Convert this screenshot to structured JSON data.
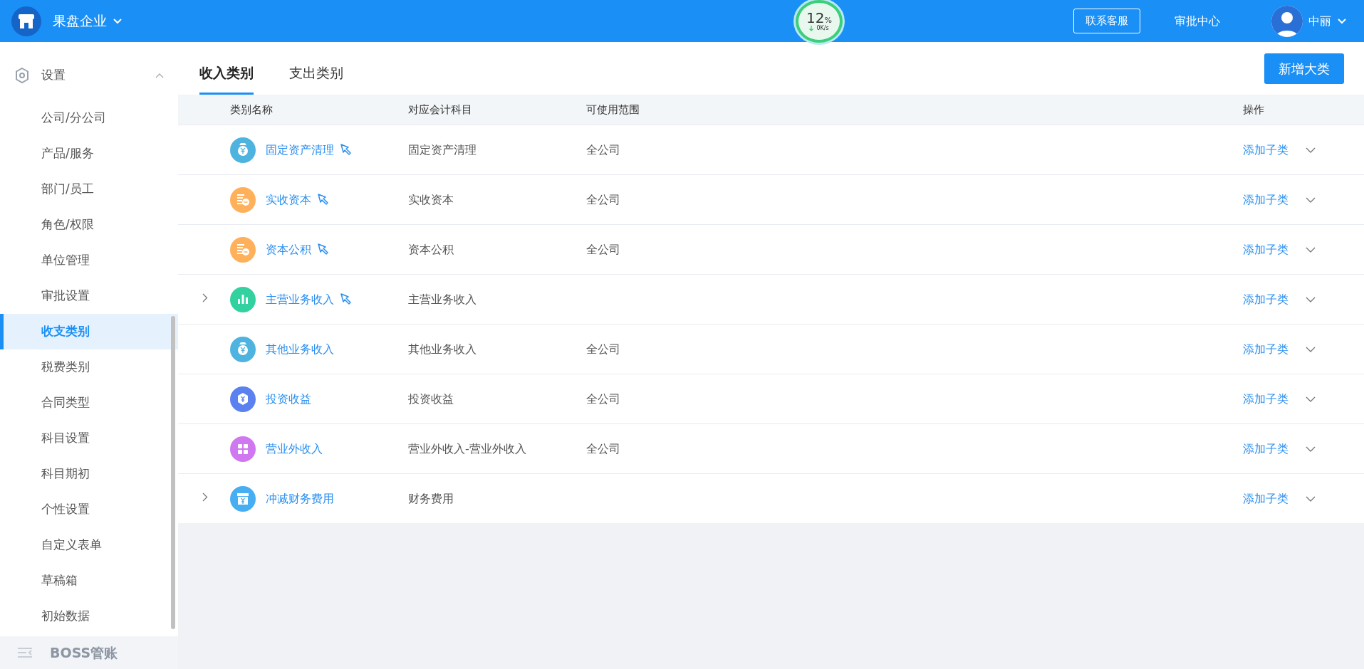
{
  "header": {
    "company": "果盘企业",
    "monitor": {
      "value": "12",
      "unit": "%",
      "speed": "0K/s"
    },
    "support_button": "联系客服",
    "approval_link": "审批中心",
    "user": "中丽"
  },
  "sidebar": {
    "group": {
      "label": "设置",
      "expanded": true
    },
    "items": [
      {
        "label": "公司/分公司",
        "selected": false
      },
      {
        "label": "产品/服务",
        "selected": false
      },
      {
        "label": "部门/员工",
        "selected": false
      },
      {
        "label": "角色/权限",
        "selected": false
      },
      {
        "label": "单位管理",
        "selected": false
      },
      {
        "label": "审批设置",
        "selected": false
      },
      {
        "label": "收支类别",
        "selected": true
      },
      {
        "label": "税费类别",
        "selected": false
      },
      {
        "label": "合同类型",
        "selected": false
      },
      {
        "label": "科目设置",
        "selected": false
      },
      {
        "label": "科目期初",
        "selected": false
      },
      {
        "label": "个性设置",
        "selected": false
      },
      {
        "label": "自定义表单",
        "selected": false
      },
      {
        "label": "草稿箱",
        "selected": false
      },
      {
        "label": "初始数据",
        "selected": false
      }
    ],
    "footer": "BOSS管账"
  },
  "tabs": [
    {
      "label": "收入类别",
      "selected": true
    },
    {
      "label": "支出类别",
      "selected": false
    }
  ],
  "add_button": "新增大类",
  "table": {
    "columns": [
      "类别名称",
      "对应会计科目",
      "可使用范围",
      "操作"
    ],
    "rows": [
      {
        "name": "固定资产清理",
        "kind": "bag",
        "color": "#4fb3e0",
        "pinned": true,
        "expandable": false,
        "account": "固定资产清理",
        "scope": "全公司",
        "action": "添加子类"
      },
      {
        "name": "实收资本",
        "kind": "coins",
        "color": "#ffb05a",
        "pinned": true,
        "expandable": false,
        "account": "实收资本",
        "scope": "全公司",
        "action": "添加子类"
      },
      {
        "name": "资本公积",
        "kind": "coins",
        "color": "#ffb05a",
        "pinned": true,
        "expandable": false,
        "account": "资本公积",
        "scope": "全公司",
        "action": "添加子类"
      },
      {
        "name": "主营业务收入",
        "kind": "chart",
        "color": "#33d19f",
        "pinned": true,
        "expandable": true,
        "account": "主营业务收入",
        "action": "添加子类"
      },
      {
        "name": "其他业务收入",
        "kind": "bag",
        "color": "#4fb3e0",
        "pinned": false,
        "expandable": false,
        "account": "其他业务收入",
        "scope": "全公司",
        "action": "添加子类"
      },
      {
        "name": "投资收益",
        "kind": "hexagon",
        "color": "#5b80f0",
        "pinned": false,
        "expandable": false,
        "account": "投资收益",
        "scope": "全公司",
        "action": "添加子类"
      },
      {
        "name": "营业外收入",
        "kind": "grid",
        "color": "#cf78ef",
        "pinned": false,
        "expandable": false,
        "account": "营业外收入-营业外收入",
        "scope": "全公司",
        "action": "添加子类"
      },
      {
        "name": "冲减财务费用",
        "kind": "box",
        "color": "#48aef2",
        "pinned": false,
        "expandable": true,
        "account": "财务费用",
        "action": "添加子类"
      }
    ]
  }
}
